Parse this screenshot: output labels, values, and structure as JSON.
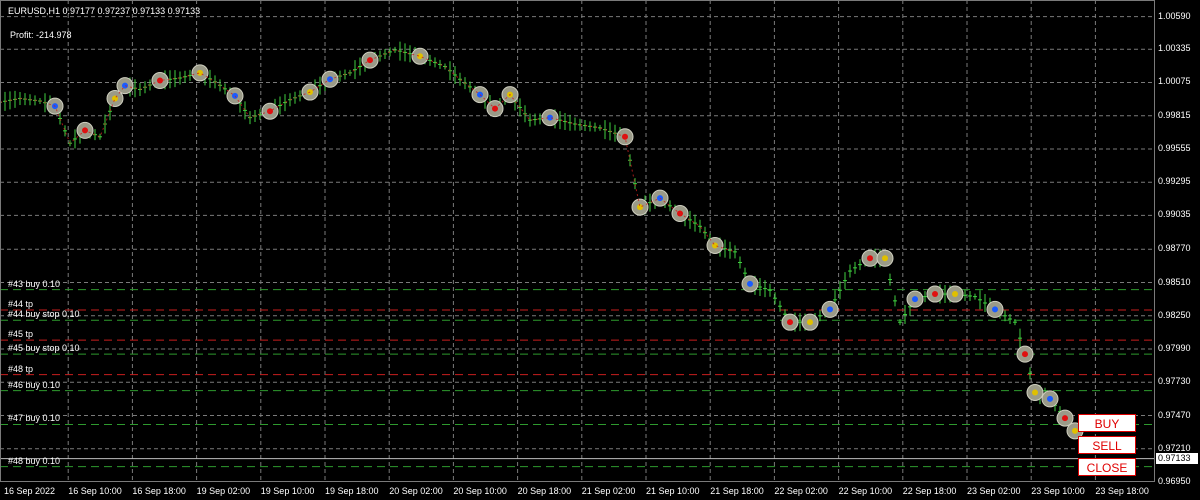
{
  "header": {
    "symbol_line": "EURUSD,H1  0.97177 0.97237 0.97133 0.97133",
    "profit_line": "Profit: -214.978"
  },
  "price_axis": {
    "labels": [
      "1.00590",
      "1.00335",
      "1.00075",
      "0.99815",
      "0.99555",
      "0.99295",
      "0.99035",
      "0.98770",
      "0.98510",
      "0.98250",
      "0.97990",
      "0.97730",
      "0.97470",
      "0.97210",
      "0.96950"
    ],
    "current_price": "0.97133"
  },
  "time_axis": {
    "labels": [
      "16 Sep 2022",
      "16 Sep 10:00",
      "16 Sep 18:00",
      "19 Sep 02:00",
      "19 Sep 10:00",
      "19 Sep 18:00",
      "20 Sep 02:00",
      "20 Sep 10:00",
      "20 Sep 18:00",
      "21 Sep 02:00",
      "21 Sep 10:00",
      "21 Sep 18:00",
      "22 Sep 02:00",
      "22 Sep 10:00",
      "22 Sep 18:00",
      "23 Sep 02:00",
      "23 Sep 10:00",
      "23 Sep 18:00"
    ]
  },
  "order_lines": [
    {
      "label": "#43 buy 0.10",
      "price": 0.98455,
      "color": "#2e9a2e"
    },
    {
      "label": "#44 tp",
      "price": 0.98295,
      "color": "#c81e1e"
    },
    {
      "label": "#44 buy stop 0.10",
      "price": 0.98215,
      "color": "#2e9a2e"
    },
    {
      "label": "#45 tp",
      "price": 0.9806,
      "color": "#c81e1e"
    },
    {
      "label": "#45 buy stop 0.10",
      "price": 0.9795,
      "color": "#2e9a2e"
    },
    {
      "label": "#48 tp",
      "price": 0.9779,
      "color": "#c81e1e"
    },
    {
      "label": "#46 buy 0.10",
      "price": 0.97665,
      "color": "#2e9a2e"
    },
    {
      "label": "#47 buy 0.10",
      "price": 0.974,
      "color": "#2e9a2e"
    },
    {
      "label": "#48 buy 0.10",
      "price": 0.9707,
      "color": "#2e9a2e"
    }
  ],
  "buttons": {
    "buy": "BUY",
    "sell": "SELL",
    "close": "CLOSE"
  },
  "colors": {
    "background": "#000000",
    "grid": "#7a7a7a",
    "candle": "#3fd13f",
    "buy_line": "#2e9a2e",
    "tp_line": "#c81e1e",
    "button_text": "#e00000"
  },
  "chart_data": {
    "type": "line",
    "title": "EURUSD,H1",
    "ylim": [
      0.9695,
      1.0072
    ],
    "price": [
      [
        0,
        0.9992
      ],
      [
        20,
        0.9995
      ],
      [
        40,
        0.9993
      ],
      [
        55,
        0.9989
      ],
      [
        70,
        0.996
      ],
      [
        85,
        0.997
      ],
      [
        100,
        0.9965
      ],
      [
        115,
        0.9995
      ],
      [
        125,
        1.0005
      ],
      [
        140,
        1.0002
      ],
      [
        160,
        1.0009
      ],
      [
        180,
        1.0011
      ],
      [
        200,
        1.0015
      ],
      [
        215,
        1.0008
      ],
      [
        235,
        0.9997
      ],
      [
        250,
        0.998
      ],
      [
        270,
        0.9985
      ],
      [
        290,
        0.9994
      ],
      [
        310,
        1.0
      ],
      [
        330,
        1.001
      ],
      [
        350,
        1.0015
      ],
      [
        370,
        1.0025
      ],
      [
        395,
        1.0033
      ],
      [
        420,
        1.0028
      ],
      [
        445,
        1.002
      ],
      [
        460,
        1.001
      ],
      [
        480,
        0.9998
      ],
      [
        495,
        0.9987
      ],
      [
        510,
        0.9998
      ],
      [
        530,
        0.9978
      ],
      [
        550,
        0.998
      ],
      [
        575,
        0.9975
      ],
      [
        600,
        0.9972
      ],
      [
        625,
        0.9965
      ],
      [
        640,
        0.991
      ],
      [
        660,
        0.9917
      ],
      [
        680,
        0.9905
      ],
      [
        700,
        0.9895
      ],
      [
        715,
        0.988
      ],
      [
        735,
        0.9875
      ],
      [
        750,
        0.985
      ],
      [
        770,
        0.9845
      ],
      [
        790,
        0.982
      ],
      [
        810,
        0.982
      ],
      [
        830,
        0.983
      ],
      [
        850,
        0.986
      ],
      [
        870,
        0.987
      ],
      [
        885,
        0.987
      ],
      [
        900,
        0.982
      ],
      [
        915,
        0.9838
      ],
      [
        935,
        0.9842
      ],
      [
        955,
        0.9842
      ],
      [
        975,
        0.984
      ],
      [
        995,
        0.983
      ],
      [
        1015,
        0.982
      ],
      [
        1025,
        0.9795
      ],
      [
        1035,
        0.9765
      ],
      [
        1050,
        0.976
      ],
      [
        1065,
        0.9745
      ],
      [
        1075,
        0.9735
      ],
      [
        1085,
        0.97133
      ]
    ]
  }
}
